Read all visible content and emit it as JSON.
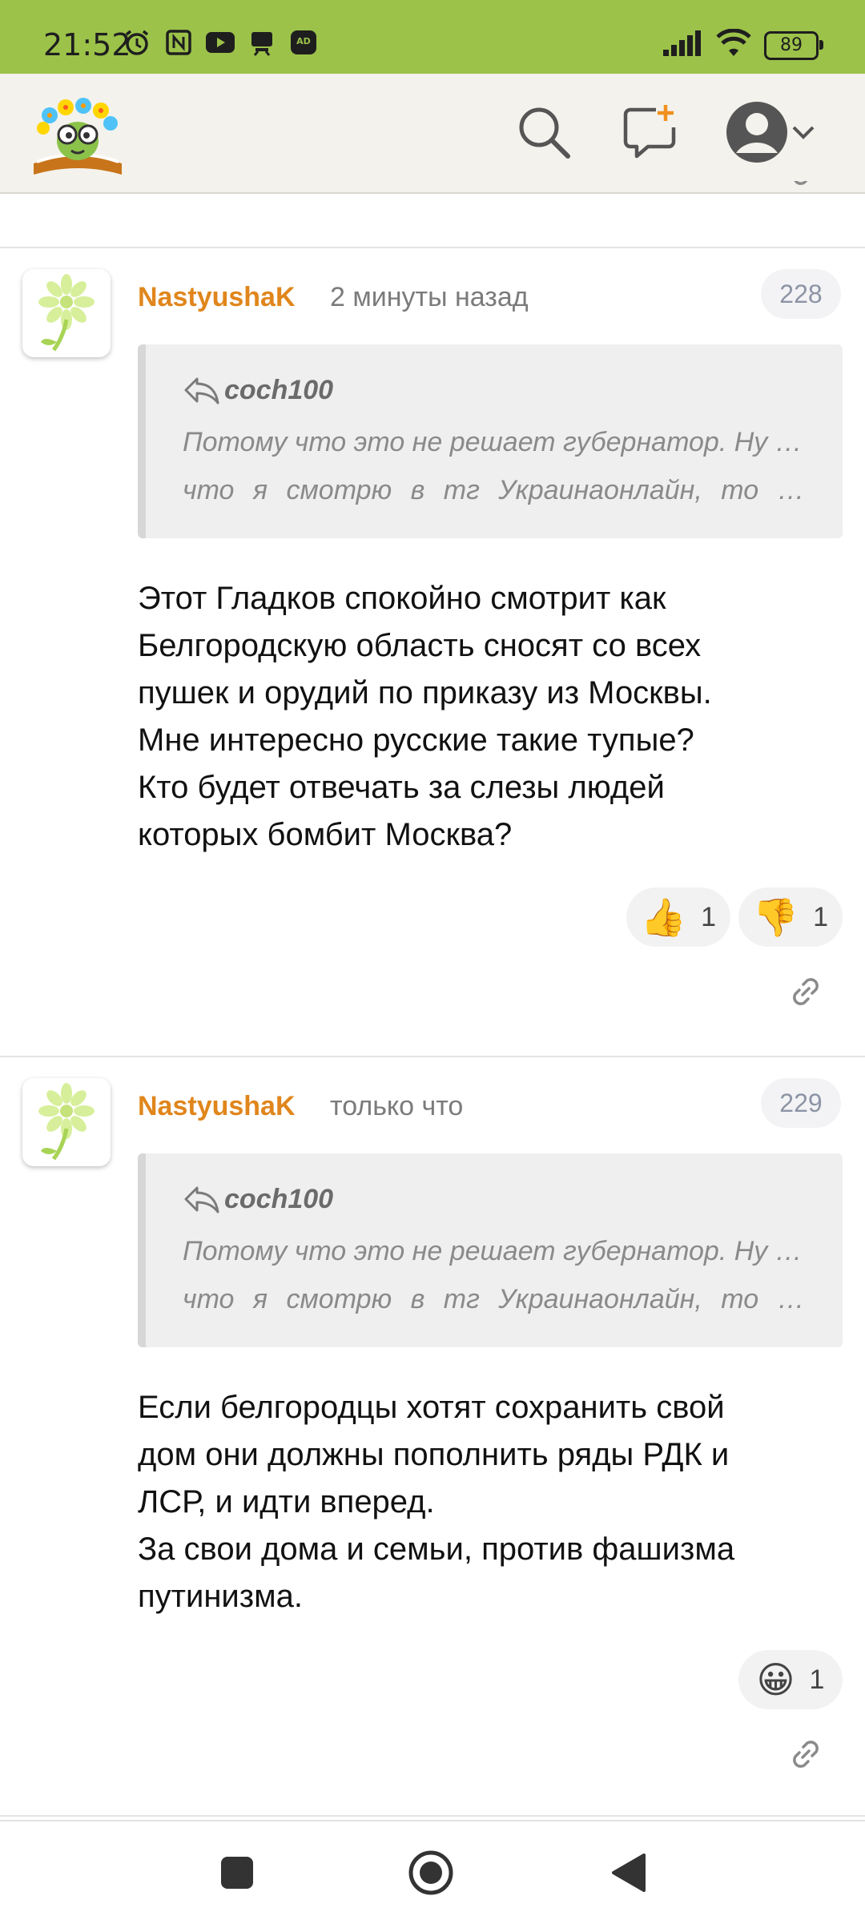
{
  "status_bar": {
    "time": "21:52",
    "battery": "89",
    "left_icons": [
      "alarm-icon",
      "nfc-icon",
      "youtube-icon",
      "cast-icon",
      "ad-icon"
    ],
    "right_icons": [
      "signal-icon",
      "wifi-icon",
      "battery-icon"
    ]
  },
  "header": {
    "logo": "site-logo",
    "icons": [
      "search-icon",
      "new-message-icon",
      "avatar-icon",
      "chevron-down-icon"
    ]
  },
  "comments": [
    {
      "author": "NastyushaK",
      "time": "2 минуты назад",
      "number": "228",
      "quote": {
        "author": "coch100",
        "line1": "Потому что это не решает губернатор. Ну и то",
        "line2": "что я смотрю в тг Украинаонлайн, то бы..."
      },
      "lines": [
        "Этот Гладков спокойно смотрит как",
        "Белгородскую область сносят со всех",
        "пушек и орудий по приказу из Москвы.",
        "Мне интересно русские такие тупые?",
        "Кто будет отвечать за слезы людей",
        "которых бомбит Москва?"
      ],
      "reactions": [
        {
          "emoji": "👍",
          "count": "1"
        },
        {
          "emoji": "👎",
          "count": "1"
        }
      ]
    },
    {
      "author": "NastyushaK",
      "time": "только что",
      "number": "229",
      "quote": {
        "author": "coch100",
        "line1": "Потому что это не решает губернатор. Ну и то",
        "line2": "что я смотрю в тг Украинаонлайн, то бы..."
      },
      "lines": [
        "Если белгородцы хотят сохранить свой",
        "дом они должны пополнить ряды РДК и",
        "ЛСР, и идти вперед.",
        "За свои дома и семьи, против фашизма",
        "путинизма."
      ],
      "reactions": [
        {
          "emoji": "😀",
          "count": "1"
        }
      ]
    }
  ],
  "nav": [
    "recents-icon",
    "home-icon",
    "back-icon"
  ]
}
